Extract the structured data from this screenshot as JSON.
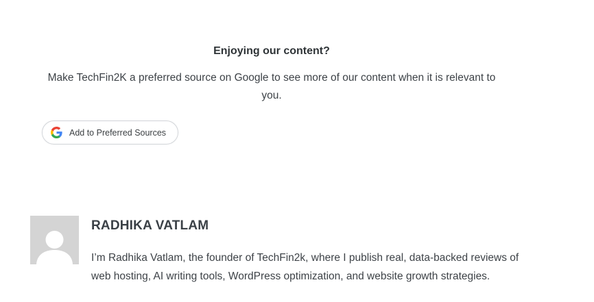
{
  "promo": {
    "title": "Enjoying our content?",
    "text": "Make TechFin2K a preferred source on Google to see more of our content when it is relevant to you.",
    "button_label": "Add to Preferred Sources",
    "button_icon": "google-g-icon"
  },
  "author": {
    "avatar_icon": "default-user-avatar",
    "name": "RADHIKA VATLAM",
    "bio": "I’m Radhika Vatlam, the founder of TechFin2k, where I publish real, data-backed reviews of web hosting, AI writing tools, WordPress optimization, and website growth strategies."
  },
  "colors": {
    "text": "#3d4247",
    "heading": "#2f3437",
    "avatar_bg": "#d4d4d4",
    "button_border": "#d3d6da",
    "google_blue": "#4285F4",
    "google_red": "#EA4335",
    "google_yellow": "#FBBC05",
    "google_green": "#34A853"
  }
}
